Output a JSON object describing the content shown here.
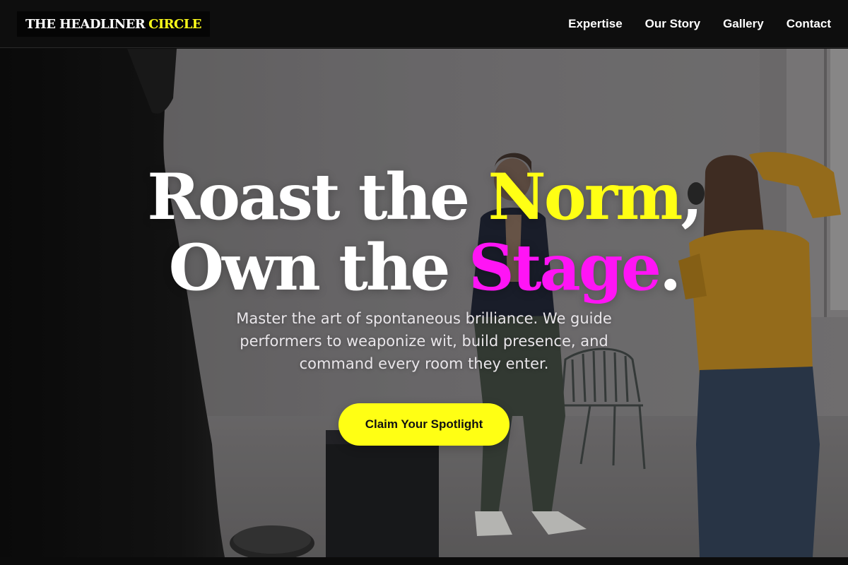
{
  "brand": {
    "name_part1": "THE HEADLINER",
    "name_part2": "CIRCLE"
  },
  "nav": {
    "links": [
      "Expertise",
      "Our Story",
      "Gallery",
      "Contact"
    ]
  },
  "hero": {
    "headline": {
      "line1_prefix": "Roast the ",
      "line1_highlight": "Norm",
      "line1_suffix": ",",
      "line2_prefix": "Own the ",
      "line2_highlight": "Stage",
      "line2_suffix": "."
    },
    "subtitle": "Master the art of spontaneous brilliance. We guide performers to weaponize wit, build presence, and command every room they enter.",
    "cta_label": "Claim Your Spotlight"
  },
  "colors": {
    "accent_yellow": "#ffff14",
    "accent_magenta": "#ff14f5",
    "nav_background": "#0e0e0e"
  }
}
